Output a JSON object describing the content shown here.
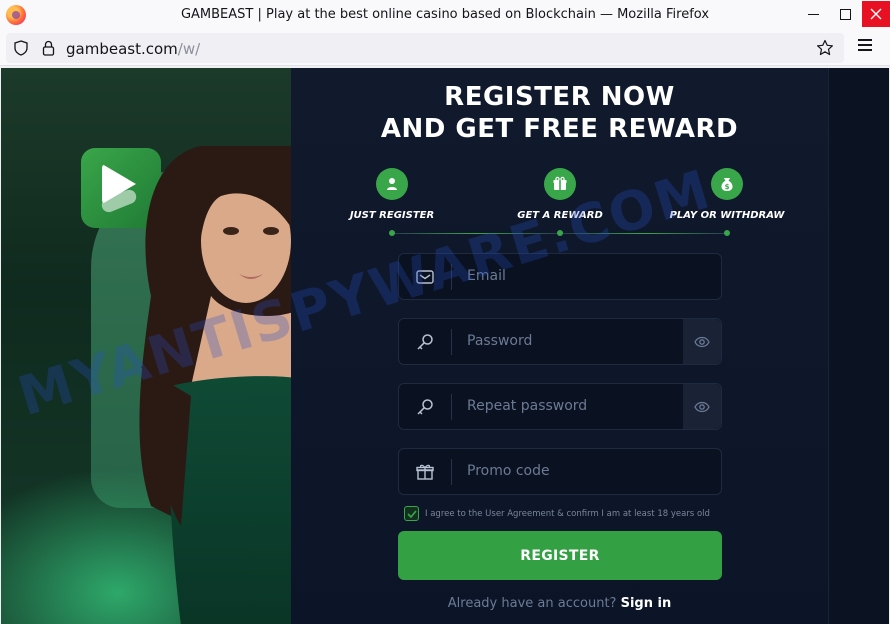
{
  "browser": {
    "window_title": "GAMBEAST | Play at the best online casino based on Blockchain — Mozilla Firefox",
    "url_domain": "gambeast.com",
    "url_path": "/w/"
  },
  "page": {
    "headline_line1": "REGISTER NOW",
    "headline_line2": "AND GET FREE REWARD",
    "steps": [
      {
        "label": "JUST REGISTER",
        "icon": "user-icon"
      },
      {
        "label": "GET A REWARD",
        "icon": "gift-icon"
      },
      {
        "label": "PLAY OR WITHDRAW",
        "icon": "money-bag-icon"
      }
    ],
    "form": {
      "email_placeholder": "Email",
      "password_placeholder": "Password",
      "repeat_password_placeholder": "Repeat password",
      "promo_placeholder": "Promo code",
      "agree_text": "I agree to the User Agreement & confirm I am at least 18 years old",
      "agree_checked": true,
      "register_label": "REGISTER",
      "signin_prompt": "Already have an account?",
      "signin_link": "Sign in"
    },
    "watermark": "MYANTISPYWARE.COM",
    "colors": {
      "accent": "#33a043",
      "background": "#0d1424"
    }
  }
}
